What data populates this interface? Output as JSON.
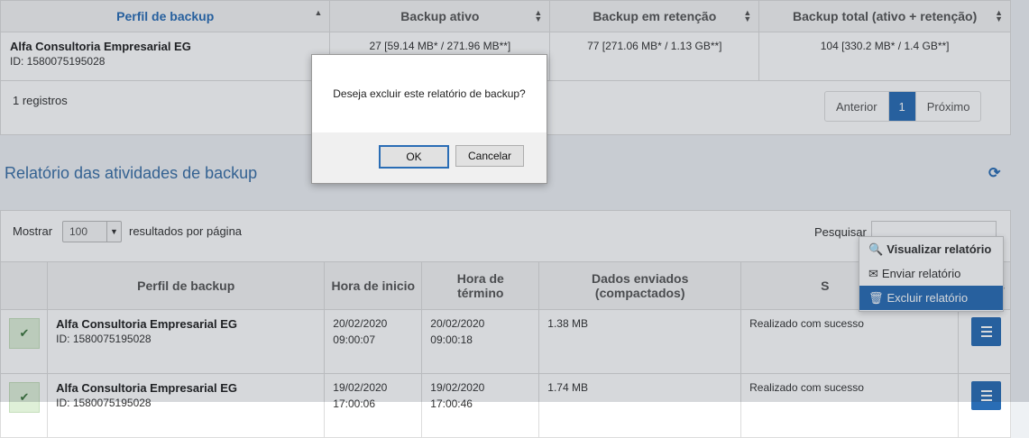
{
  "top_table": {
    "headers": [
      "Perfil de backup",
      "Backup ativo",
      "Backup em retenção",
      "Backup total (ativo + retenção)"
    ],
    "row": {
      "name": "Alfa Consultoria Empresarial EG",
      "id": "ID: 1580075195028",
      "active": "27 [59.14 MB* / 271.96 MB**]",
      "retention": "77 [271.06 MB* / 1.13 GB**]",
      "total": "104 [330.2 MB* / 1.4 GB**]"
    },
    "records": "1 registros",
    "pager": {
      "prev": "Anterior",
      "page": "1",
      "next": "Próximo"
    }
  },
  "section": {
    "title": "Relatório das atividades de backup"
  },
  "controls": {
    "show_label": "Mostrar",
    "show_value": "100",
    "per_page_label": "resultados por página",
    "search_label": "Pesquisar"
  },
  "activity_table": {
    "headers": [
      "Perfil de backup",
      "Hora de inicio",
      "Hora de término",
      "Dados enviados (compactados)",
      "S"
    ],
    "header_tail": "s",
    "rows": [
      {
        "name": "Alfa Consultoria Empresarial EG",
        "id": "ID: 1580075195028",
        "start_date": "20/02/2020",
        "start_time": "09:00:07",
        "end_date": "20/02/2020",
        "end_time": "09:00:18",
        "data": "1.38 MB",
        "status": "Realizado com sucesso"
      },
      {
        "name": "Alfa Consultoria Empresarial EG",
        "id": "ID: 1580075195028",
        "start_date": "19/02/2020",
        "start_time": "17:00:06",
        "end_date": "19/02/2020",
        "end_time": "17:00:46",
        "data": "1.74 MB",
        "status": "Realizado com sucesso"
      }
    ]
  },
  "context_menu": {
    "view": "Visualizar relatório",
    "send": "Enviar relatório",
    "delete": "Excluir relatório"
  },
  "dialog": {
    "message": "Deseja excluir este relatório de backup?",
    "ok": "OK",
    "cancel": "Cancelar"
  },
  "colors": {
    "accent": "#2a6db5",
    "success": "#dff0d8"
  }
}
